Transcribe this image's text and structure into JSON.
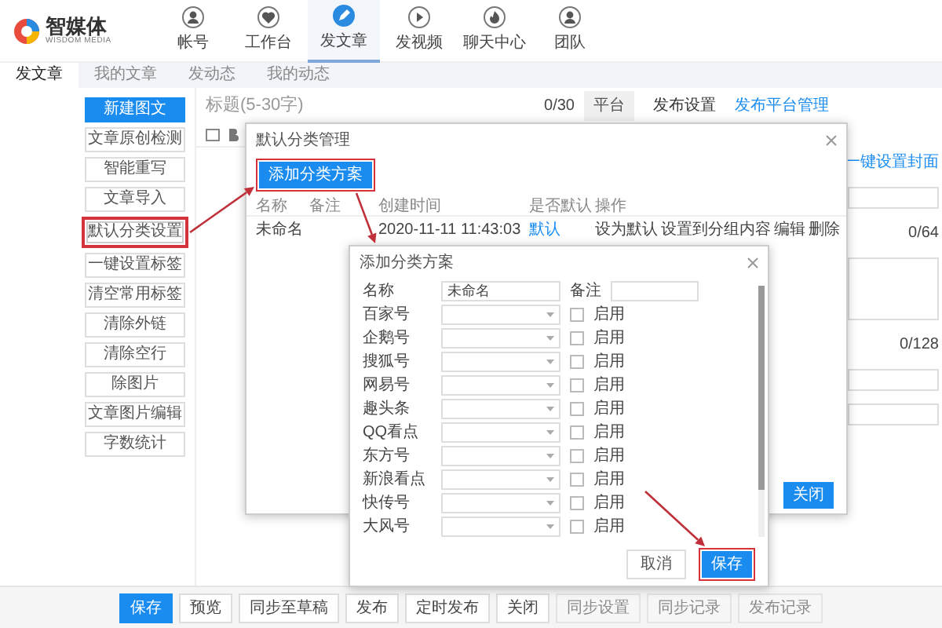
{
  "header": {
    "logo": {
      "title": "智媒体",
      "subtitle": "WISDOM MEDIA"
    },
    "nav": [
      {
        "label": "帐号",
        "selected": false
      },
      {
        "label": "工作台",
        "selected": false
      },
      {
        "label": "发文章",
        "selected": true
      },
      {
        "label": "发视频",
        "selected": false
      },
      {
        "label": "聊天中心",
        "selected": false
      },
      {
        "label": "团队",
        "selected": false
      }
    ]
  },
  "subtabs": [
    {
      "label": "发文章",
      "selected": true
    },
    {
      "label": "我的文章",
      "selected": false
    },
    {
      "label": "发动态",
      "selected": false
    },
    {
      "label": "我的动态",
      "selected": false
    }
  ],
  "tools": [
    {
      "label": "新建图文",
      "primary": true,
      "callout": false
    },
    {
      "label": "文章原创检测",
      "primary": false,
      "callout": false
    },
    {
      "label": "智能重写",
      "primary": false,
      "callout": false
    },
    {
      "label": "文章导入",
      "primary": false,
      "callout": false
    },
    {
      "label": "默认分类设置",
      "primary": false,
      "callout": true
    },
    {
      "label": "一键设置标签",
      "primary": false,
      "callout": false
    },
    {
      "label": "清空常用标签",
      "primary": false,
      "callout": false
    },
    {
      "label": "清除外链",
      "primary": false,
      "callout": false
    },
    {
      "label": "清除空行",
      "primary": false,
      "callout": false
    },
    {
      "label": "除图片",
      "primary": false,
      "callout": false
    },
    {
      "label": "文章图片编辑",
      "primary": false,
      "callout": false
    },
    {
      "label": "字数统计",
      "primary": false,
      "callout": false
    }
  ],
  "editor": {
    "title_placeholder": "标题(5-30字)",
    "title_count": "0/30",
    "tabs": [
      {
        "label": "平台",
        "selected": false
      },
      {
        "label": "发布设置",
        "selected": true
      }
    ],
    "manage_link": "发布平台管理"
  },
  "side_panel": {
    "cover_link": "一键设置封面",
    "summary_count": "0/64",
    "desc_count": "0/128"
  },
  "category_dialog": {
    "title": "默认分类管理",
    "add_button": "添加分类方案",
    "add_callout": true,
    "columns": [
      "名称",
      "备注",
      "创建时间",
      "是否默认",
      "操作"
    ],
    "rows": [
      {
        "name": "未命名",
        "created": "2020-11-11 11:43:03",
        "default": "默认",
        "actions": [
          "设为默认",
          "设置到分组内容",
          "编辑",
          "删除"
        ]
      }
    ],
    "close_button": "关闭"
  },
  "add_dialog": {
    "title": "添加分类方案",
    "name_label": "名称",
    "name_value": "未命名",
    "note_label": "备注",
    "platforms": [
      {
        "label": "百家号",
        "enabled": false,
        "option": "启用"
      },
      {
        "label": "企鹅号",
        "enabled": false,
        "option": "启用"
      },
      {
        "label": "搜狐号",
        "enabled": false,
        "option": "启用"
      },
      {
        "label": "网易号",
        "enabled": false,
        "option": "启用"
      },
      {
        "label": "趣头条",
        "enabled": false,
        "option": "启用"
      },
      {
        "label": "QQ看点",
        "enabled": false,
        "option": "启用"
      },
      {
        "label": "东方号",
        "enabled": false,
        "option": "启用"
      },
      {
        "label": "新浪看点",
        "enabled": false,
        "option": "启用"
      },
      {
        "label": "快传号",
        "enabled": false,
        "option": "启用"
      },
      {
        "label": "大风号",
        "enabled": false,
        "option": "启用"
      }
    ],
    "cancel_button": "取消",
    "save_button": "保存",
    "save_callout": true
  },
  "bottom_bar": [
    {
      "label": "保存",
      "kind": "primary"
    },
    {
      "label": "预览",
      "kind": "normal"
    },
    {
      "label": "同步至草稿",
      "kind": "normal"
    },
    {
      "label": "发布",
      "kind": "normal"
    },
    {
      "label": "定时发布",
      "kind": "normal"
    },
    {
      "label": "关闭",
      "kind": "normal"
    },
    {
      "label": "同步设置",
      "kind": "disabled"
    },
    {
      "label": "同步记录",
      "kind": "disabled"
    },
    {
      "label": "发布记录",
      "kind": "disabled"
    }
  ]
}
